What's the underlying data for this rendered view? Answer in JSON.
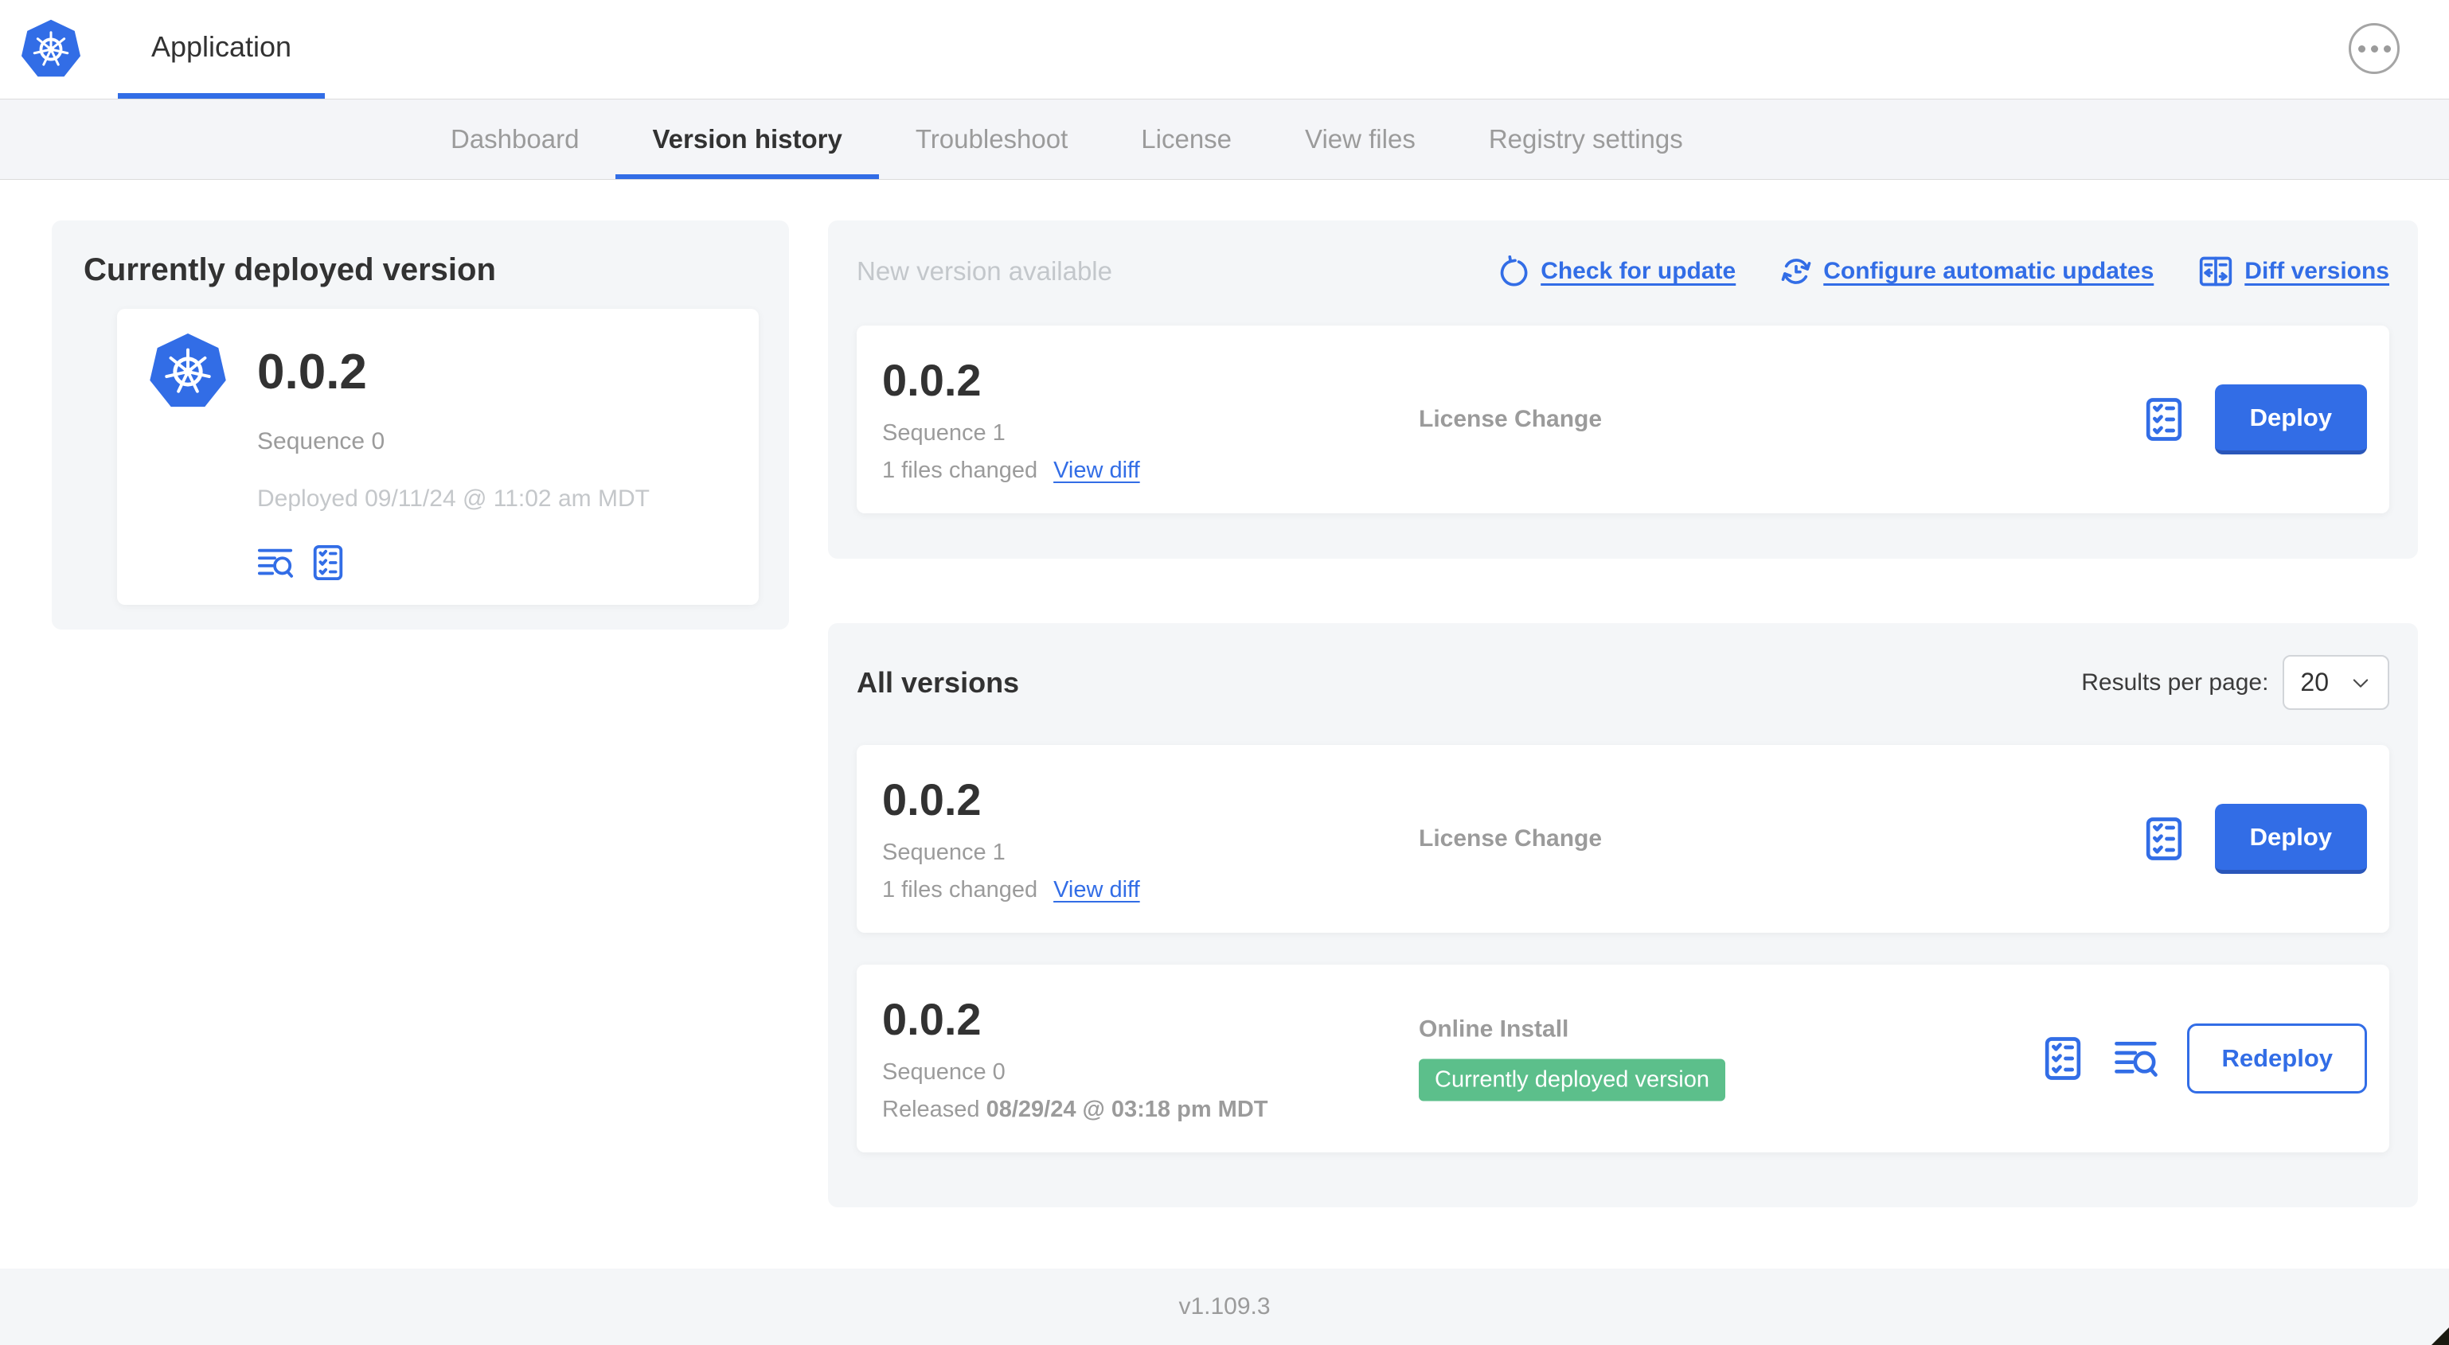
{
  "header": {
    "app_title": "Application"
  },
  "nav": {
    "active_tab": "Version history",
    "tabs": [
      {
        "label": "Dashboard"
      },
      {
        "label": "Version history"
      },
      {
        "label": "Troubleshoot"
      },
      {
        "label": "License"
      },
      {
        "label": "View files"
      },
      {
        "label": "Registry settings"
      }
    ]
  },
  "deployed": {
    "title": "Currently deployed version",
    "version": "0.0.2",
    "sequence": "Sequence 0",
    "deployed_at": "Deployed 09/11/24 @ 11:02 am MDT"
  },
  "new_version": {
    "section_title": "New version available",
    "check_for_update": "Check for update",
    "configure_updates": "Configure automatic updates",
    "diff_versions": "Diff versions",
    "version": "0.0.2",
    "sequence": "Sequence 1",
    "files_changed": "1 files changed",
    "view_diff": "View diff",
    "source": "License Change",
    "deploy_label": "Deploy"
  },
  "all_versions": {
    "section_title": "All versions",
    "results_per_page_label": "Results per page:",
    "results_per_page_value": "20",
    "rows": [
      {
        "version": "0.0.2",
        "sequence": "Sequence 1",
        "files_changed": "1 files changed",
        "view_diff": "View diff",
        "source": "License Change",
        "action_label": "Deploy"
      },
      {
        "version": "0.0.2",
        "sequence": "Sequence 0",
        "released_prefix": "Released ",
        "released_date": "08/29/24 @ 03:18 pm MDT",
        "source": "Online Install",
        "badge": "Currently deployed version",
        "action_label": "Redeploy"
      }
    ]
  },
  "footer": {
    "app_version": "v1.109.3"
  },
  "colors": {
    "brand_blue": "#326de6",
    "badge_green": "#5cbf8b",
    "active_text": "#323232",
    "muted_text": "#9b9b9b",
    "faint_text": "#c4c7ca",
    "card_bg": "#f4f6f8"
  }
}
